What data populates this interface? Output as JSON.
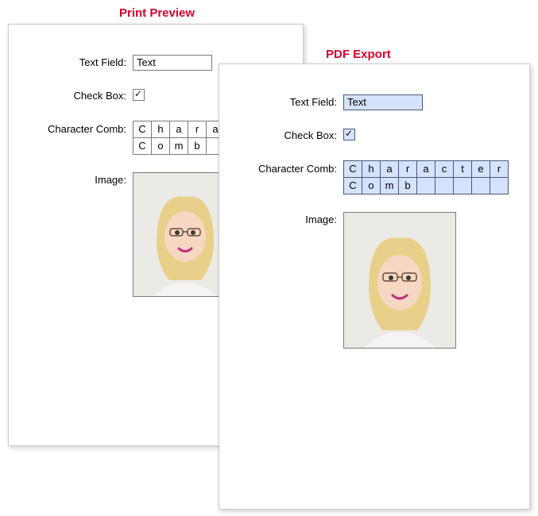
{
  "titles": {
    "print": "Print Preview",
    "pdf": "PDF Export"
  },
  "labels": {
    "text_field": "Text Field:",
    "check_box": "Check Box:",
    "character_comb": "Character Comb:",
    "image": "Image:"
  },
  "print": {
    "text_field_value": "Text",
    "check_box_checked": true,
    "comb_rows": [
      [
        "C",
        "h",
        "a",
        "r",
        "a"
      ],
      [
        "C",
        "o",
        "m",
        "b",
        ""
      ]
    ],
    "comb_cols": 5
  },
  "pdf": {
    "text_field_value": "Text",
    "check_box_checked": true,
    "comb_rows": [
      [
        "C",
        "h",
        "a",
        "r",
        "a",
        "c",
        "t",
        "e",
        "r"
      ],
      [
        "C",
        "o",
        "m",
        "b",
        "",
        "",
        "",
        "",
        ""
      ]
    ],
    "comb_cols": 9
  },
  "image_desc": "portrait-photo"
}
